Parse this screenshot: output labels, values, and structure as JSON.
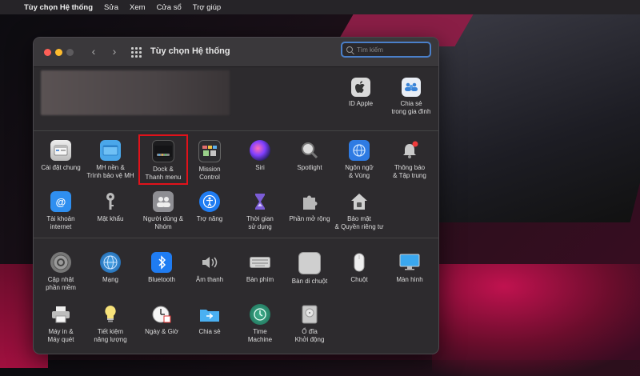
{
  "menubar": {
    "apple": "",
    "items": [
      "Tùy chọn Hệ thống",
      "Sửa",
      "Xem",
      "Cửa sổ",
      "Trợ giúp"
    ]
  },
  "window": {
    "title": "Tùy chọn Hệ thống",
    "search_placeholder": "Tìm kiếm"
  },
  "account": {
    "items": [
      {
        "label": "ID Apple",
        "icon": "apple-id-icon"
      },
      {
        "label": "Chia sẻ\ntrong gia đình",
        "icon": "family-sharing-icon"
      }
    ]
  },
  "section1": {
    "row1": [
      {
        "label": "Cài đặt chung",
        "icon": "general-icon"
      },
      {
        "label": "MH nền &\nTrình bảo vệ MH",
        "icon": "desktop-screensaver-icon"
      },
      {
        "label": "Dock &\nThanh menu",
        "icon": "dock-menubar-icon"
      },
      {
        "label": "Mission\nControl",
        "icon": "mission-control-icon"
      },
      {
        "label": "Siri",
        "icon": "siri-icon"
      },
      {
        "label": "Spotlight",
        "icon": "spotlight-icon"
      },
      {
        "label": "Ngôn ngữ\n& Vùng",
        "icon": "language-region-icon"
      },
      {
        "label": "Thông báo\n& Tập trung",
        "icon": "notifications-icon"
      }
    ],
    "row2": [
      {
        "label": "Tài khoản\ninternet",
        "icon": "internet-accounts-icon"
      },
      {
        "label": "Mật khẩu",
        "icon": "passwords-icon"
      },
      {
        "label": "Người dùng &\nNhóm",
        "icon": "users-groups-icon"
      },
      {
        "label": "Trợ năng",
        "icon": "accessibility-icon"
      },
      {
        "label": "Thời gian\nsử dụng",
        "icon": "screen-time-icon"
      },
      {
        "label": "Phần mở rộng",
        "icon": "extensions-icon"
      },
      {
        "label": "Bảo mật\n& Quyền riêng tư",
        "icon": "security-privacy-icon"
      }
    ]
  },
  "section2": {
    "row1": [
      {
        "label": "Cập nhật\nphần mềm",
        "icon": "software-update-icon"
      },
      {
        "label": "Mạng",
        "icon": "network-icon"
      },
      {
        "label": "Bluetooth",
        "icon": "bluetooth-icon"
      },
      {
        "label": "Âm thanh",
        "icon": "sound-icon"
      },
      {
        "label": "Bàn phím",
        "icon": "keyboard-icon"
      },
      {
        "label": "Bàn di chuột",
        "icon": "trackpad-icon"
      },
      {
        "label": "Chuột",
        "icon": "mouse-icon"
      },
      {
        "label": "Màn hình",
        "icon": "displays-icon"
      }
    ],
    "row2": [
      {
        "label": "Máy in &\nMáy quét",
        "icon": "printers-scanners-icon"
      },
      {
        "label": "Tiết kiệm\nnăng lượng",
        "icon": "energy-saver-icon"
      },
      {
        "label": "Ngày & Giờ",
        "icon": "date-time-icon"
      },
      {
        "label": "Chia sẻ",
        "icon": "sharing-icon"
      },
      {
        "label": "Time\nMachine",
        "icon": "time-machine-icon"
      },
      {
        "label": "Ổ đĩa\nKhởi động",
        "icon": "startup-disk-icon"
      }
    ]
  },
  "colors": {
    "highlight_box": "#e0121a",
    "search_focus": "#4a7fc9"
  }
}
